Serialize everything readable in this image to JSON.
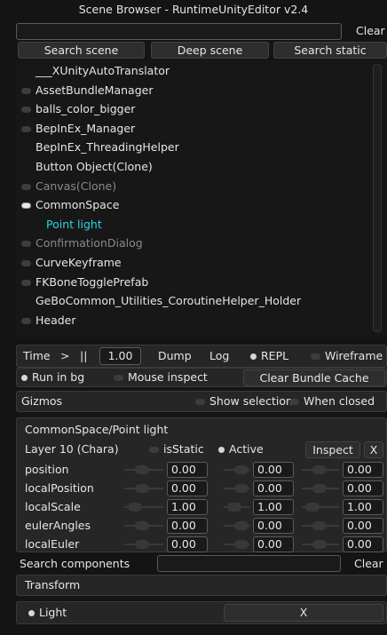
{
  "window": {
    "title": "Scene Browser - RuntimeUnityEditor v2.4"
  },
  "search": {
    "value": "",
    "clear_label": "Clear"
  },
  "search_buttons": [
    "Search scene",
    "Deep scene",
    "Search static"
  ],
  "objects": [
    {
      "label": "___XUnityAutoTranslator",
      "toggle": "none",
      "state": "normal"
    },
    {
      "label": "AssetBundleManager",
      "toggle": "off",
      "state": "normal"
    },
    {
      "label": "balls_color_bigger",
      "toggle": "off",
      "state": "normal"
    },
    {
      "label": "BepInEx_Manager",
      "toggle": "off",
      "state": "normal"
    },
    {
      "label": "BepInEx_ThreadingHelper",
      "toggle": "none",
      "state": "normal"
    },
    {
      "label": "Button Object(Clone)",
      "toggle": "none",
      "state": "normal"
    },
    {
      "label": "Canvas(Clone)",
      "toggle": "off",
      "state": "inactive"
    },
    {
      "label": "CommonSpace",
      "toggle": "on",
      "state": "normal"
    },
    {
      "label": "Point light",
      "toggle": "none",
      "state": "selected"
    },
    {
      "label": "ConfirmationDialog",
      "toggle": "off",
      "state": "inactive"
    },
    {
      "label": "CurveKeyframe",
      "toggle": "off",
      "state": "normal"
    },
    {
      "label": "FKBoneTogglePrefab",
      "toggle": "off",
      "state": "normal"
    },
    {
      "label": "GeBoCommon_Utilities_CoroutineHelper_Holder",
      "toggle": "none",
      "state": "normal"
    },
    {
      "label": "Header",
      "toggle": "off",
      "state": "normal"
    }
  ],
  "toolbar1": {
    "time_label": "Time",
    "step_label": ">",
    "pause_label": "||",
    "time_value": "1.00",
    "dump_label": "Dump",
    "log_label": "Log",
    "repl_label": "REPL",
    "wireframe_label": "Wireframe"
  },
  "toolbar2": {
    "run_in_bg_label": "Run in bg",
    "mouse_inspect_label": "Mouse inspect",
    "clear_cache_label": "Clear Bundle Cache"
  },
  "gizmos": {
    "label": "Gizmos",
    "show_selection_label": "Show selection",
    "when_closed_label": "When closed"
  },
  "inspector": {
    "path": "CommonSpace/Point light",
    "layer": "Layer 10 (Chara)",
    "is_static_label": "isStatic",
    "active_label": "Active",
    "inspect_label": "Inspect",
    "close_label": "X",
    "transforms": [
      {
        "label": "position",
        "values": [
          "0.00",
          "0.00",
          "0.00"
        ]
      },
      {
        "label": "localPosition",
        "values": [
          "0.00",
          "0.00",
          "0.00"
        ]
      },
      {
        "label": "localScale",
        "values": [
          "1.00",
          "1.00",
          "1.00"
        ]
      },
      {
        "label": "eulerAngles",
        "values": [
          "0.00",
          "0.00",
          "0.00"
        ]
      },
      {
        "label": "localEuler",
        "values": [
          "0.00",
          "0.00",
          "0.00"
        ]
      }
    ],
    "search_components_label": "Search components",
    "search_components_value": "",
    "clear_label": "Clear",
    "components": [
      {
        "label": "Transform"
      },
      {
        "label": "Light",
        "remove_label": "X"
      }
    ]
  }
}
